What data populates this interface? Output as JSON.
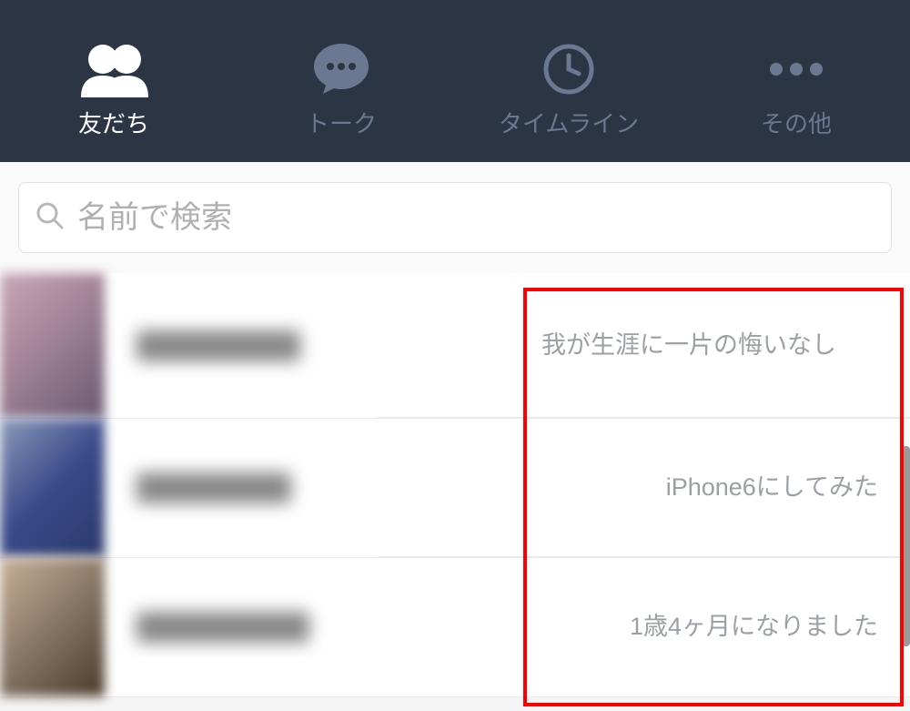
{
  "tabs": {
    "friends": {
      "label": "友だち",
      "active": true
    },
    "talk": {
      "label": "トーク",
      "active": false
    },
    "timeline": {
      "label": "タイムライン",
      "active": false
    },
    "other": {
      "label": "その他",
      "active": false
    }
  },
  "search": {
    "placeholder": "名前で検索"
  },
  "friends": [
    {
      "status": "我が生涯に一片の悔いなし"
    },
    {
      "status": "iPhone6にしてみた"
    },
    {
      "status": "1歳4ヶ月になりました"
    }
  ]
}
